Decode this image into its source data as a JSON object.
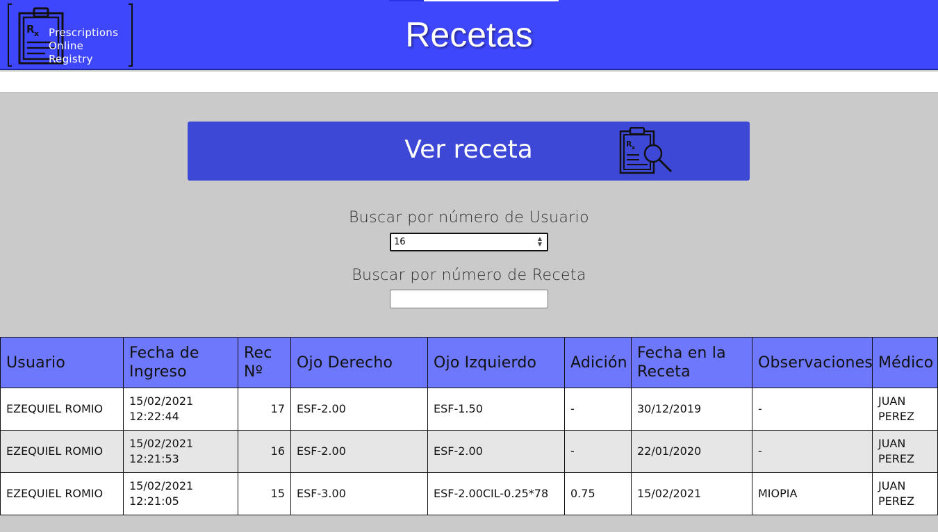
{
  "header": {
    "logo_lines": [
      "Prescriptions",
      "Online",
      "Registry"
    ],
    "title": "Recetas",
    "bg_color": "#3f47fd"
  },
  "view_button": {
    "label": "Ver receta",
    "icon": "prescription-search-icon"
  },
  "search": {
    "by_user_label": "Buscar por número de Usuario",
    "by_user_value": "16",
    "by_recipe_label": "Buscar por número de Receta",
    "by_recipe_value": ""
  },
  "table": {
    "columns": [
      "Usuario",
      "Fecha de Ingreso",
      "Rec Nº",
      "Ojo Derecho",
      "Ojo Izquierdo",
      "Adición",
      "Fecha en la Receta",
      "Observaciones",
      "Médico"
    ],
    "rows": [
      [
        "EZEQUIEL ROMIO",
        "15/02/2021 12:22:44",
        "17",
        "ESF-2.00",
        "ESF-1.50",
        "-",
        "30/12/2019",
        "-",
        "JUAN PEREZ"
      ],
      [
        "EZEQUIEL ROMIO",
        "15/02/2021 12:21:53",
        "16",
        "ESF-2.00",
        "ESF-2.00",
        "-",
        "22/01/2020",
        "-",
        "JUAN PEREZ"
      ],
      [
        "EZEQUIEL ROMIO",
        "15/02/2021 12:21:05",
        "15",
        "ESF-3.00",
        "ESF-2.00CIL-0.25*78",
        "0.75",
        "15/02/2021",
        "MIOPIA",
        "JUAN PEREZ"
      ]
    ]
  },
  "colors": {
    "header": "#3f47fd",
    "button": "#3e48d6",
    "table_header": "#6e78fd",
    "background": "#cacaca"
  }
}
